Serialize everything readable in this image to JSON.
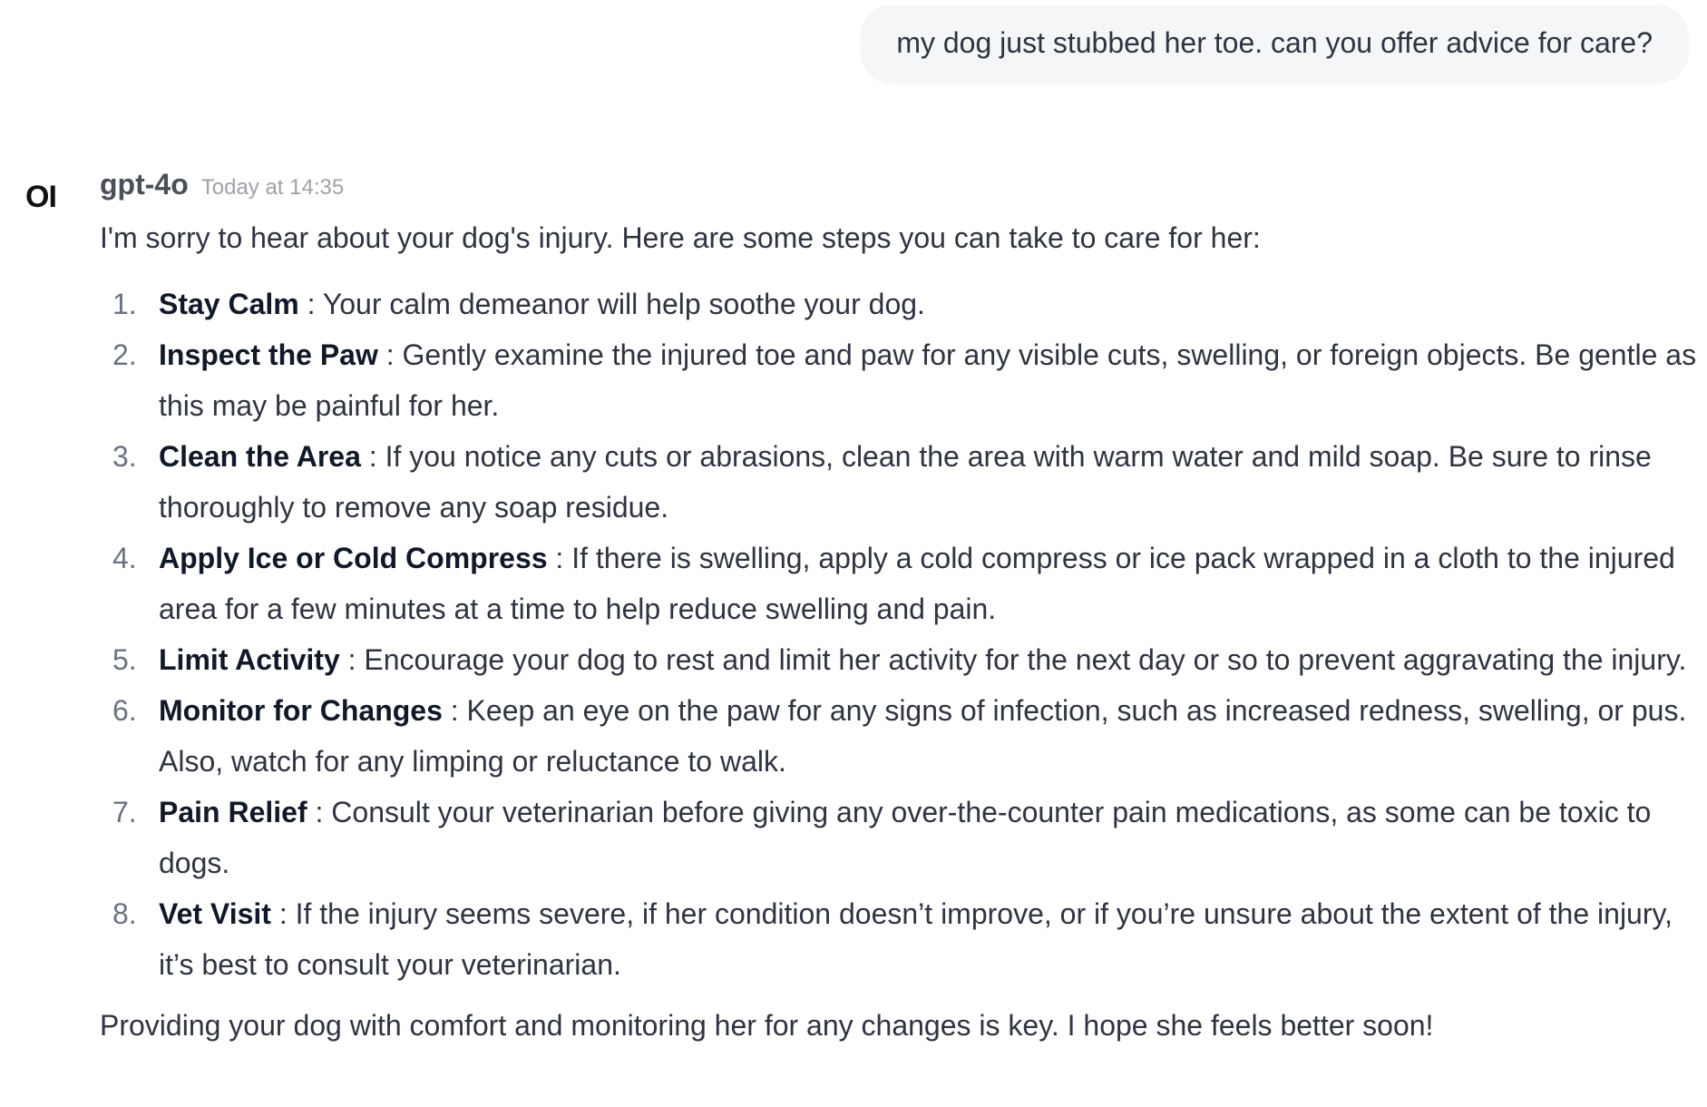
{
  "user_message": "my dog just stubbed her toe. can you offer advice for care?",
  "assistant": {
    "avatar_text": "OI",
    "model_name": "gpt-4o",
    "timestamp": "Today at 14:35",
    "intro": "I'm sorry to hear about your dog's injury. Here are some steps you can take to care for her:",
    "steps": [
      {
        "num": "1.",
        "title": "Stay Calm",
        "text": " : Your calm demeanor will help soothe your dog."
      },
      {
        "num": "2.",
        "title": "Inspect the Paw",
        "text": " : Gently examine the injured toe and paw for any visible cuts, swelling, or foreign objects. Be gentle as this may be painful for her."
      },
      {
        "num": "3.",
        "title": "Clean the Area",
        "text": " : If you notice any cuts or abrasions, clean the area with warm water and mild soap. Be sure to rinse thoroughly to remove any soap residue."
      },
      {
        "num": "4.",
        "title": "Apply Ice or Cold Compress",
        "text": " : If there is swelling, apply a cold compress or ice pack wrapped in a cloth to the injured area for a few minutes at a time to help reduce swelling and pain."
      },
      {
        "num": "5.",
        "title": "Limit Activity",
        "text": " : Encourage your dog to rest and limit her activity for the next day or so to prevent aggravating the injury."
      },
      {
        "num": "6.",
        "title": "Monitor for Changes",
        "text": " : Keep an eye on the paw for any signs of infection, such as increased redness, swelling, or pus. Also, watch for any limping or reluctance to walk."
      },
      {
        "num": "7.",
        "title": "Pain Relief",
        "text": " : Consult your veterinarian before giving any over-the-counter pain medications, as some can be toxic to dogs."
      },
      {
        "num": "8.",
        "title": "Vet Visit",
        "text": " : If the injury seems severe, if her condition doesn’t improve, or if you’re unsure about the extent of the injury, it’s best to consult your veterinarian."
      }
    ],
    "outro": "Providing your dog with comfort and monitoring her for any changes is key. I hope she feels better soon!"
  }
}
